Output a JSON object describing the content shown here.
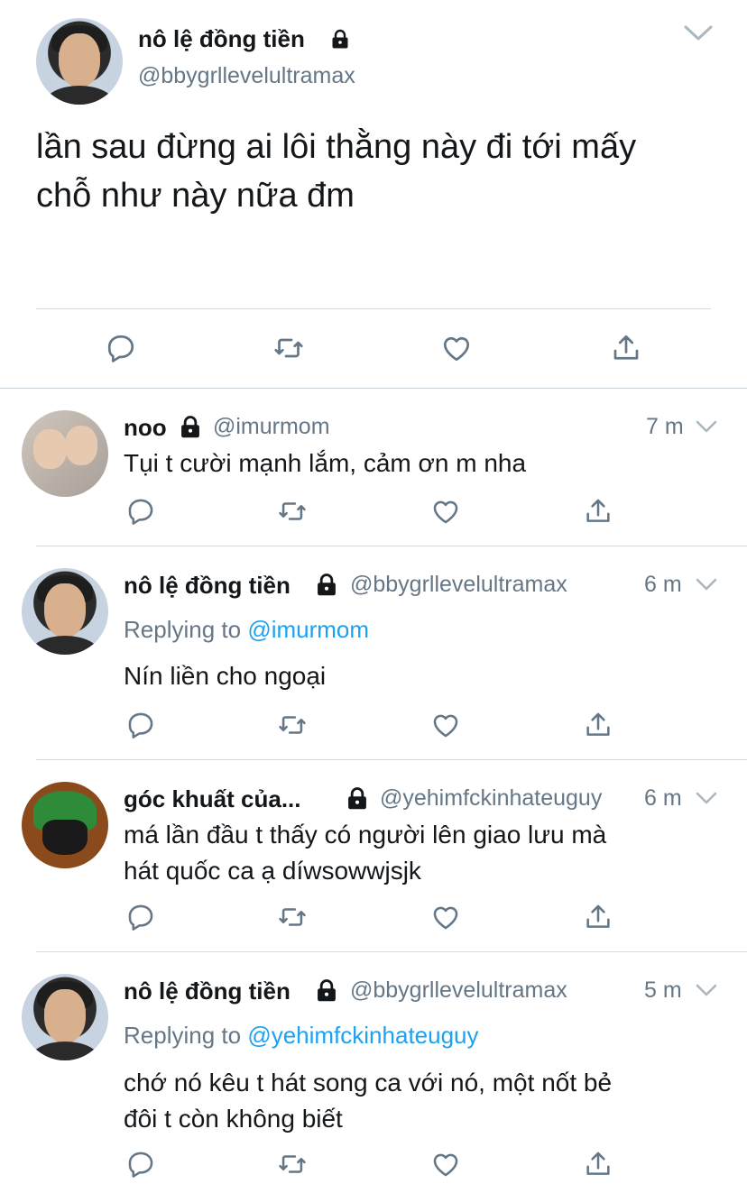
{
  "main_tweet": {
    "author_name": "nô lệ đồng tiền",
    "author_handle": "@bbygrllevelultramax",
    "text_line1": "lần sau đừng ai lôi thằng này đi tới mấy",
    "text_line2": "chỗ như này nữa đm"
  },
  "replies": [
    {
      "name": "noo",
      "handle": "@imurmom",
      "time": "7 m",
      "text_lines": [
        "Tụi t cười mạnh lắm, cảm ơn m nha"
      ]
    },
    {
      "name": "nô lệ đồng tiền",
      "handle": "@bbygrllevelultramax",
      "time": "6 m",
      "replying_label": "Replying to",
      "replying_to": "@imurmom",
      "text_lines": [
        "Nín liền cho ngoại"
      ]
    },
    {
      "name": "góc khuất của...",
      "handle": "@yehimfckinhateuguy",
      "time": "6 m",
      "text_lines": [
        "má lần đầu t thấy có người lên giao lưu mà",
        "hát quốc ca ạ díwsowwjsjk"
      ]
    },
    {
      "name": "nô lệ đồng tiền",
      "handle": "@bbygrllevelultramax",
      "time": "5 m",
      "replying_label": "Replying to",
      "replying_to": "@yehimfckinhateuguy",
      "text_lines": [
        "chớ nó kêu t hát song ca với nó, một nốt bẻ",
        "đôi t còn không biết"
      ]
    }
  ],
  "icons": {
    "reply": "reply-icon",
    "retweet": "retweet-icon",
    "like": "heart-icon",
    "share": "share-icon",
    "lock": "lock-icon",
    "caret": "chevron-down-icon"
  },
  "colors": {
    "text": "#14171a",
    "secondary": "#657786",
    "link": "#1da1f2",
    "icon": "#657786",
    "divider": "#d6dbe0"
  }
}
